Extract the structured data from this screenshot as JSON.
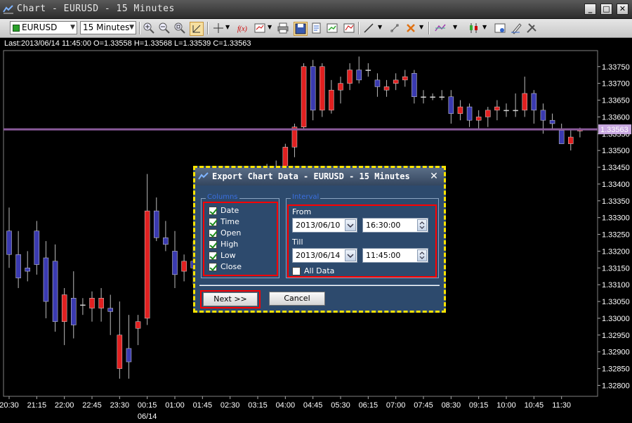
{
  "window": {
    "title": "Chart - EURUSD - 15 Minutes",
    "minimize": "_",
    "restore": "□",
    "close": "✕"
  },
  "toolbar": {
    "symbol": "EURUSD",
    "timeframe": "15 Minutes",
    "icons": [
      "zoom-in-icon",
      "zoom-out-icon",
      "zoom-fit-icon",
      "autoscroll-icon",
      "crosshair-icon",
      "indicator-icon",
      "chart-type-icon",
      "print-icon",
      "save-icon",
      "copy-icon",
      "export-icon",
      "refresh-icon",
      "line-tool-icon",
      "fibonacci-icon",
      "delete-drawing-icon",
      "object-list-icon",
      "candle-style-icon",
      "properties-icon",
      "settings-icon",
      "tools-icon"
    ]
  },
  "chart": {
    "info": "Last:2013/06/14 11:45:00 O=1.33558 H=1.33568 L=1.33539 C=1.33563",
    "current_price": "1.33563",
    "price_labels": [
      "1.33750",
      "1.33700",
      "1.33650",
      "1.33600",
      "1.33550",
      "1.33500",
      "1.33450",
      "1.33400",
      "1.33350",
      "1.33300",
      "1.33250",
      "1.33200",
      "1.33150",
      "1.33100",
      "1.33050",
      "1.33000",
      "1.32950",
      "1.32900",
      "1.32850",
      "1.32800"
    ],
    "time_labels": [
      "20:30",
      "21:15",
      "22:00",
      "22:45",
      "23:30",
      "00:15",
      "01:00",
      "01:45",
      "02:30",
      "03:15",
      "04:00",
      "04:45",
      "05:30",
      "06:15",
      "07:00",
      "07:45",
      "08:30",
      "09:15",
      "10:00",
      "10:45",
      "11:30"
    ],
    "date_label": "06/14",
    "colors": {
      "up": "#e02020",
      "down": "#3a3ab0",
      "doji": "#cccccc",
      "price_line": "#8a5a9a"
    }
  },
  "chart_data": {
    "type": "candlestick",
    "symbol": "EURUSD",
    "timeframe": "15 Minutes",
    "ylim": [
      1.3278,
      1.3378
    ],
    "x": [
      "20:30",
      "20:45",
      "21:00",
      "21:15",
      "21:30",
      "21:45",
      "22:00",
      "22:15",
      "22:30",
      "22:45",
      "23:00",
      "23:15",
      "23:30",
      "23:45",
      "00:00",
      "00:15",
      "00:30",
      "00:45",
      "01:00",
      "01:15",
      "01:30",
      "01:45",
      "02:00",
      "02:15",
      "02:30",
      "02:45",
      "03:00",
      "03:15",
      "03:30",
      "03:45",
      "04:00",
      "04:15",
      "04:30",
      "04:45",
      "05:00",
      "05:15",
      "05:30",
      "05:45",
      "06:00",
      "06:15",
      "06:30",
      "06:45",
      "07:00",
      "07:15",
      "07:30",
      "07:45",
      "08:00",
      "08:15",
      "08:30",
      "08:45",
      "09:00",
      "09:15",
      "09:30",
      "09:45",
      "10:00",
      "10:15",
      "10:30",
      "10:45",
      "11:00",
      "11:15",
      "11:30",
      "11:45"
    ],
    "candles": [
      [
        1.3326,
        1.3333,
        1.3315,
        1.3319
      ],
      [
        1.3319,
        1.3326,
        1.3309,
        1.3312
      ],
      [
        1.3315,
        1.332,
        1.3311,
        1.3314
      ],
      [
        1.3326,
        1.3329,
        1.3313,
        1.3316
      ],
      [
        1.3318,
        1.3323,
        1.33,
        1.3305
      ],
      [
        1.3317,
        1.3322,
        1.3296,
        1.3299
      ],
      [
        1.3299,
        1.3309,
        1.3292,
        1.3307
      ],
      [
        1.3306,
        1.3314,
        1.3294,
        1.3298
      ],
      [
        1.3304,
        1.3306,
        1.3301,
        1.3304
      ],
      [
        1.3303,
        1.3308,
        1.3299,
        1.3306
      ],
      [
        1.3303,
        1.3309,
        1.3299,
        1.3306
      ],
      [
        1.3303,
        1.3307,
        1.3295,
        1.3302
      ],
      [
        1.3285,
        1.3305,
        1.3282,
        1.3295
      ],
      [
        1.3291,
        1.3301,
        1.3282,
        1.3287
      ],
      [
        1.3297,
        1.3301,
        1.3292,
        1.3299
      ],
      [
        1.33,
        1.3343,
        1.3298,
        1.3332
      ],
      [
        1.3332,
        1.3336,
        1.3323,
        1.3324
      ],
      [
        1.3324,
        1.3329,
        1.332,
        1.3322
      ],
      [
        1.332,
        1.3326,
        1.3309,
        1.3313
      ],
      [
        1.3314,
        1.3319,
        1.3311,
        1.3317
      ],
      [
        1.3317,
        1.3323,
        1.331,
        1.3315
      ],
      [
        1.331,
        1.3318,
        1.3309,
        1.3318
      ],
      [
        1.3318,
        1.3324,
        1.3316,
        1.3323
      ],
      [
        1.3323,
        1.3329,
        1.332,
        1.3326
      ],
      [
        1.3326,
        1.3331,
        1.3322,
        1.3327
      ],
      [
        1.3327,
        1.3332,
        1.3324,
        1.333
      ],
      [
        1.333,
        1.3338,
        1.3328,
        1.3336
      ],
      [
        1.3336,
        1.3342,
        1.3333,
        1.334
      ],
      [
        1.334,
        1.3346,
        1.3339,
        1.3345
      ],
      [
        1.3345,
        1.3347,
        1.3342,
        1.3344
      ],
      [
        1.3344,
        1.3352,
        1.3342,
        1.3351
      ],
      [
        1.3351,
        1.3358,
        1.3348,
        1.3357
      ],
      [
        1.3357,
        1.3376,
        1.3356,
        1.3375
      ],
      [
        1.3375,
        1.3377,
        1.3359,
        1.3362
      ],
      [
        1.3362,
        1.3376,
        1.336,
        1.3375
      ],
      [
        1.3362,
        1.3371,
        1.3361,
        1.3368
      ],
      [
        1.3368,
        1.3372,
        1.3364,
        1.337
      ],
      [
        1.337,
        1.3376,
        1.3368,
        1.3374
      ],
      [
        1.3374,
        1.3378,
        1.337,
        1.3371
      ],
      [
        1.3374,
        1.3376,
        1.3372,
        1.3374
      ],
      [
        1.3371,
        1.3373,
        1.3366,
        1.3369
      ],
      [
        1.3368,
        1.3371,
        1.3366,
        1.3369
      ],
      [
        1.337,
        1.3373,
        1.3368,
        1.3371
      ],
      [
        1.3371,
        1.3374,
        1.3369,
        1.3372
      ],
      [
        1.3373,
        1.3374,
        1.3364,
        1.3366
      ],
      [
        1.3366,
        1.3368,
        1.3364,
        1.3366
      ],
      [
        1.3366,
        1.3367,
        1.3365,
        1.3366
      ],
      [
        1.3366,
        1.3368,
        1.3365,
        1.3366
      ],
      [
        1.3366,
        1.3368,
        1.3358,
        1.3361
      ],
      [
        1.3361,
        1.3365,
        1.3359,
        1.3363
      ],
      [
        1.3363,
        1.3364,
        1.3357,
        1.3359
      ],
      [
        1.3359,
        1.3362,
        1.3356,
        1.336
      ],
      [
        1.336,
        1.3363,
        1.3357,
        1.3362
      ],
      [
        1.3362,
        1.3365,
        1.3359,
        1.3363
      ],
      [
        1.3362,
        1.3364,
        1.336,
        1.3362
      ],
      [
        1.3362,
        1.3367,
        1.336,
        1.3362
      ],
      [
        1.3362,
        1.3372,
        1.336,
        1.3367
      ],
      [
        1.3367,
        1.3368,
        1.3358,
        1.3362
      ],
      [
        1.3362,
        1.3364,
        1.3355,
        1.3359
      ],
      [
        1.3359,
        1.3361,
        1.3356,
        1.3358
      ],
      [
        1.3356,
        1.3358,
        1.3352,
        1.3352
      ],
      [
        1.3352,
        1.3356,
        1.335,
        1.3354
      ],
      [
        1.33558,
        1.33568,
        1.33539,
        1.33563
      ]
    ]
  },
  "dialog": {
    "title": "Export Chart Data - EURUSD - 15 Minutes",
    "close": "✕",
    "columns_legend": "Columns",
    "columns": [
      {
        "label": "Date",
        "checked": true
      },
      {
        "label": "Time",
        "checked": true
      },
      {
        "label": "Open",
        "checked": true
      },
      {
        "label": "High",
        "checked": true
      },
      {
        "label": "Low",
        "checked": true
      },
      {
        "label": "Close",
        "checked": true
      }
    ],
    "interval_legend": "Interval",
    "from_label": "From",
    "from_date": "2013/06/10",
    "from_time": "16:30:00",
    "till_label": "Till",
    "till_date": "2013/06/14",
    "till_time": "11:45:00",
    "all_data_label": "All Data",
    "next_label": "Next >>",
    "cancel_label": "Cancel"
  }
}
